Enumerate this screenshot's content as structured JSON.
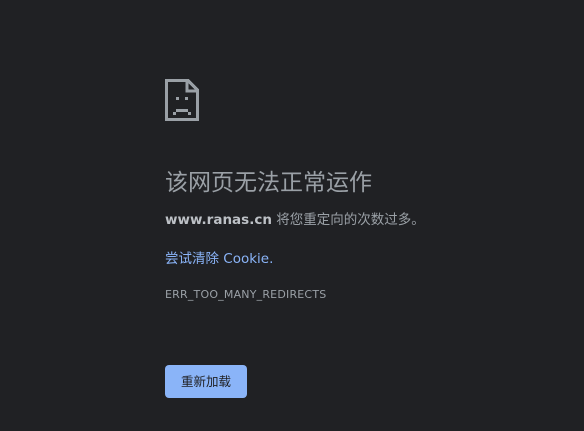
{
  "error_page": {
    "icon": "sad-page-icon",
    "title": "该网页无法正常运作",
    "host": "www.ranas.cn",
    "summary_rest": " 将您重定向的次数过多。",
    "suggestion_link": "尝试清除 Cookie.",
    "error_code": "ERR_TOO_MANY_REDIRECTS",
    "reload_label": "重新加载"
  },
  "colors": {
    "background": "#202124",
    "text": "#9aa0a6",
    "link": "#8ab4f8",
    "button": "#8ab4f8"
  }
}
